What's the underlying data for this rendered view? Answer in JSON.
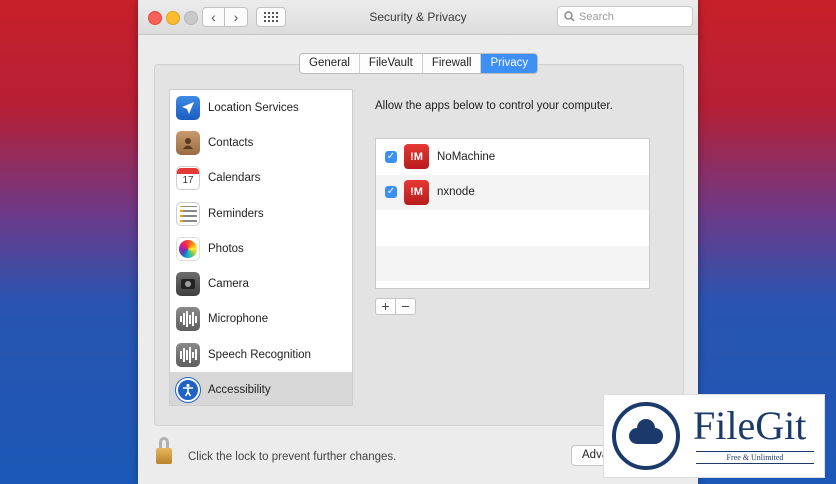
{
  "window": {
    "title": "Security & Privacy"
  },
  "search": {
    "placeholder": "Search"
  },
  "tabs": [
    {
      "label": "General",
      "active": false
    },
    {
      "label": "FileVault",
      "active": false
    },
    {
      "label": "Firewall",
      "active": false
    },
    {
      "label": "Privacy",
      "active": true
    }
  ],
  "sidebar": {
    "items": [
      {
        "label": "Location Services",
        "icon": "location-icon"
      },
      {
        "label": "Contacts",
        "icon": "contacts-icon"
      },
      {
        "label": "Calendars",
        "icon": "calendar-icon",
        "icon_text": "17"
      },
      {
        "label": "Reminders",
        "icon": "reminders-icon"
      },
      {
        "label": "Photos",
        "icon": "photos-icon"
      },
      {
        "label": "Camera",
        "icon": "camera-icon"
      },
      {
        "label": "Microphone",
        "icon": "microphone-icon"
      },
      {
        "label": "Speech Recognition",
        "icon": "speech-recognition-icon"
      },
      {
        "label": "Accessibility",
        "icon": "accessibility-icon",
        "selected": true
      }
    ]
  },
  "main": {
    "instruction": "Allow the apps below to control your computer.",
    "apps": [
      {
        "name": "NoMachine",
        "checked": true,
        "icon_text": "!M"
      },
      {
        "name": "nxnode",
        "checked": true,
        "icon_text": "!M"
      }
    ],
    "add_label": "+",
    "remove_label": "−"
  },
  "footer": {
    "lock_text": "Click the lock to prevent further changes.",
    "advanced_label": "Adva"
  },
  "watermark": {
    "name": "FileGit",
    "tagline": "Free & Unlimited"
  },
  "colors": {
    "accent": "#3b8ff5",
    "bg_top": "#c8202a",
    "bg_bottom": "#1b58b8",
    "brand": "#1b3a6b"
  }
}
